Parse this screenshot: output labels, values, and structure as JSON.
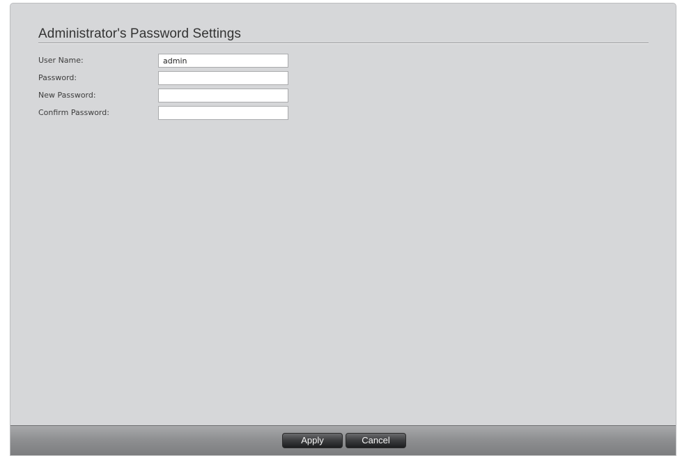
{
  "page": {
    "title": "Administrator's Password Settings"
  },
  "form": {
    "fields": [
      {
        "label": "User Name:",
        "value": "admin",
        "placeholder": ""
      },
      {
        "label": "Password:",
        "value": "",
        "placeholder": ""
      },
      {
        "label": "New Password:",
        "value": "",
        "placeholder": ""
      },
      {
        "label": "Confirm Password:",
        "value": "",
        "placeholder": ""
      }
    ]
  },
  "footer": {
    "apply_label": "Apply",
    "cancel_label": "Cancel"
  },
  "colors": {
    "panel_background": "#d6d7d9",
    "footer_bar": "#8f9092",
    "button_background": "#3a3b3d",
    "button_text": "#f4f4f4"
  }
}
